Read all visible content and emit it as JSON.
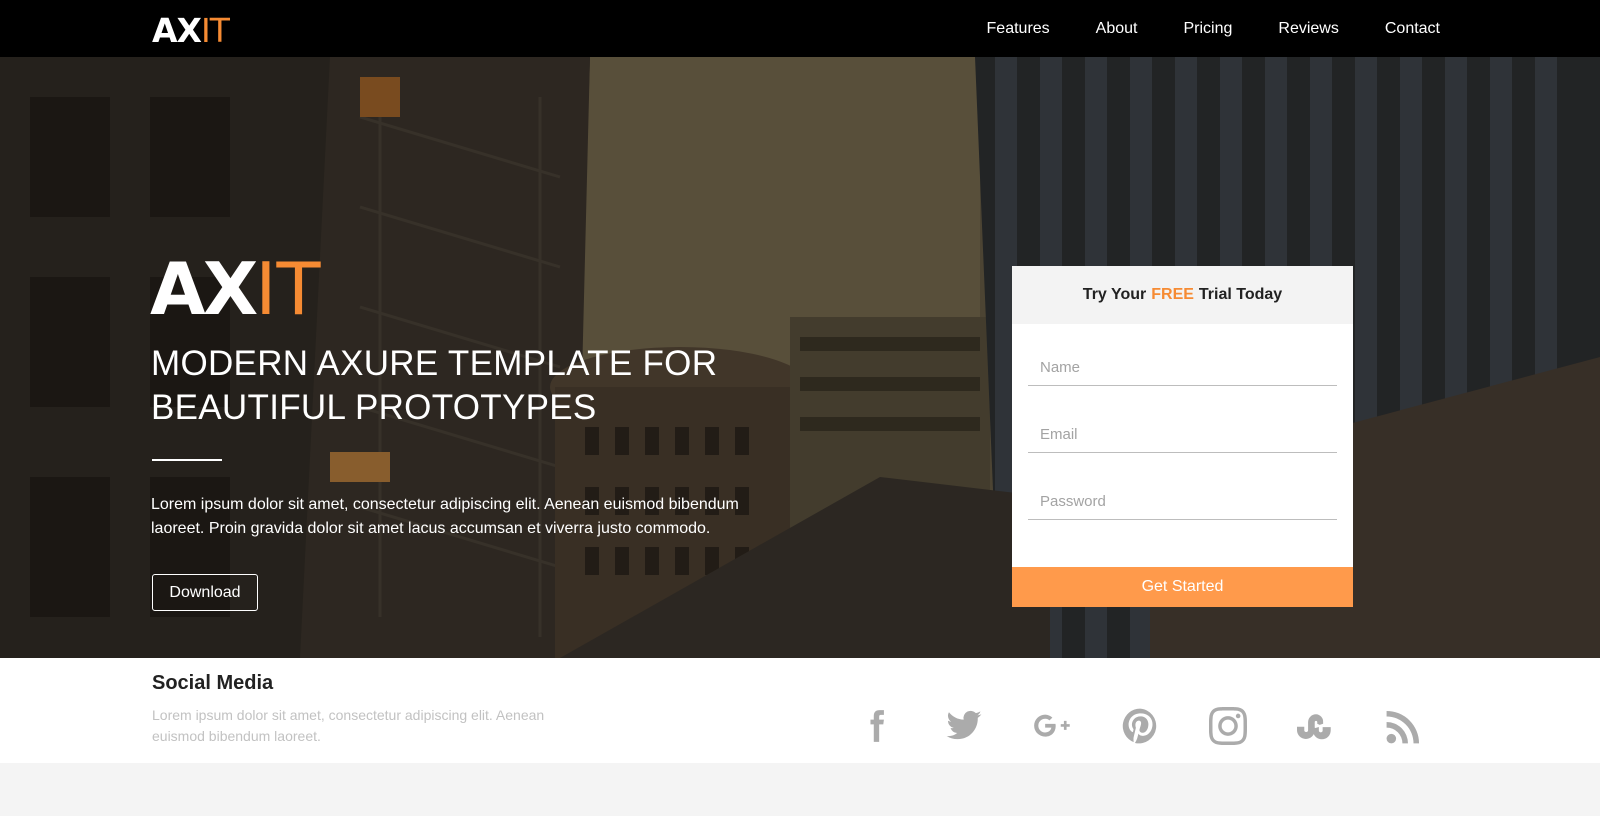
{
  "brand": {
    "main": "AX",
    "accent": "IT"
  },
  "nav": {
    "items": [
      "Features",
      "About",
      "Pricing",
      "Reviews",
      "Contact"
    ]
  },
  "hero": {
    "logo_main": "AX",
    "logo_accent": "IT",
    "title_line1": "MODERN AXURE TEMPLATE FOR",
    "title_line2": "BEAUTIFUL PROTOTYPES",
    "text": "Lorem ipsum dolor sit amet, consectetur adipiscing elit. Aenean euismod bibendum laoreet. Proin gravida dolor sit amet lacus accumsan et viverra justo commodo.",
    "download_label": "Download"
  },
  "trial": {
    "heading_before": "Try Your",
    "heading_free": "FREE",
    "heading_after": "Trial Today",
    "name_placeholder": "Name",
    "email_placeholder": "Email",
    "password_placeholder": "Password",
    "submit_label": "Get Started"
  },
  "social": {
    "title": "Social Media",
    "text": "Lorem ipsum dolor sit amet, consectetur adipiscing elit. Aenean euismod bibendum laoreet.",
    "icons": [
      "facebook-icon",
      "twitter-icon",
      "google-plus-icon",
      "pinterest-icon",
      "instagram-icon",
      "stumbleupon-icon",
      "rss-icon"
    ]
  },
  "colors": {
    "accent": "#f68b33",
    "button": "#ff9a4b",
    "nav_bg": "#000000",
    "icon_gray": "#ababab"
  }
}
